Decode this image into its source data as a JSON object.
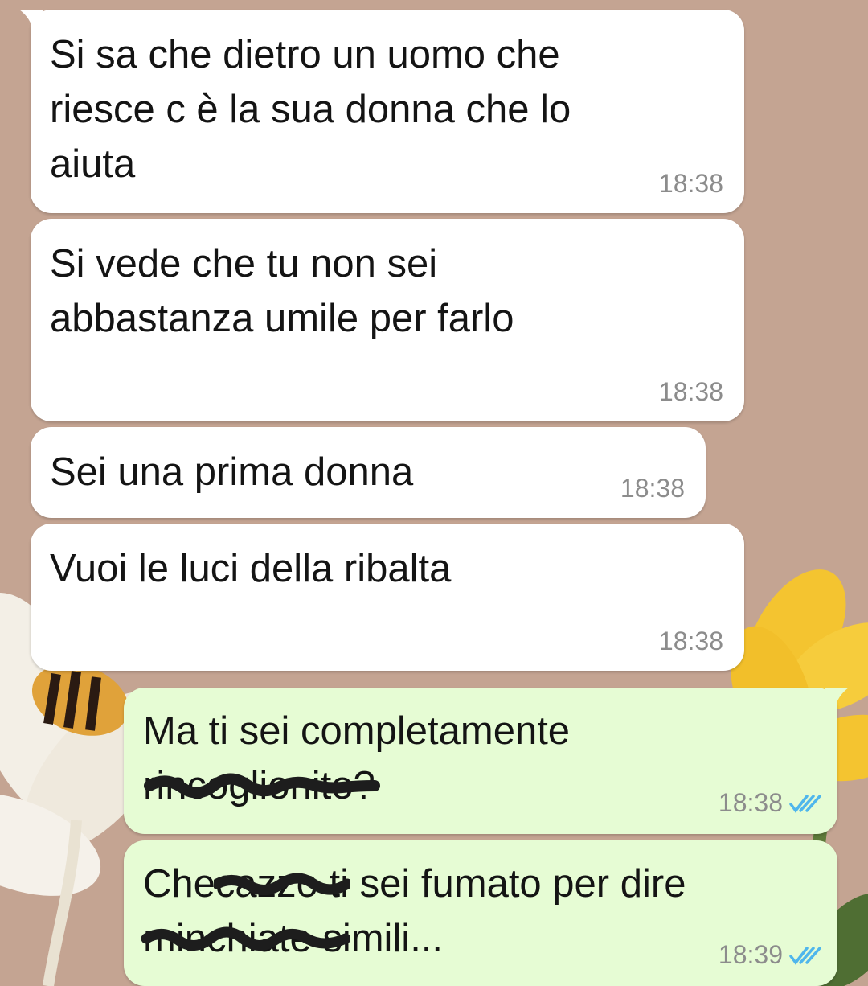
{
  "messages": [
    {
      "text": "Si sa che dietro un uomo che\nriesce c è la sua donna che lo\naiuta",
      "time": "18:38"
    },
    {
      "text": "Si vede che tu non sei\nabbastanza umile per farlo",
      "time": "18:38"
    },
    {
      "text": "Sei una prima donna",
      "time": "18:38"
    },
    {
      "text": "Vuoi le luci della ribalta",
      "time": "18:38"
    },
    {
      "line1": "Ma ti sei completamente",
      "l2_struck": "rincoglionito",
      "l2_rest": "?",
      "time": "18:38",
      "status": "read-ticks-icon"
    },
    {
      "l1_start": "Che",
      "l1_struck": "cazzo",
      "l1_rest": " ti sei fumato per dire",
      "l2_struck": "minchiate",
      "l2_rest": " simili...",
      "time": "18:39",
      "status": "read-ticks-icon"
    }
  ],
  "colors": {
    "incoming": "#ffffff",
    "outgoing": "#e6fcd4",
    "ticks": "#4fb6ec",
    "wallpaper": "#c4a492"
  }
}
